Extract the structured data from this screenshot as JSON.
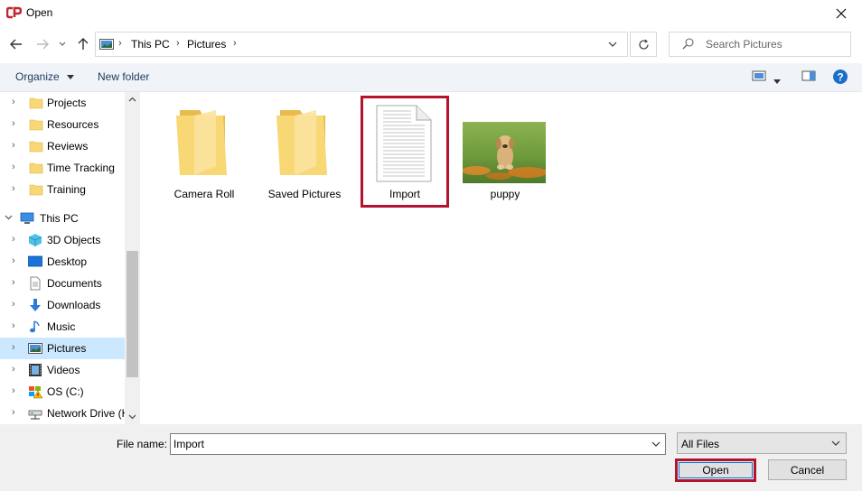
{
  "window": {
    "title": "Open"
  },
  "nav": {
    "crumbs": [
      "This PC",
      "Pictures"
    ],
    "search_placeholder": "Search Pictures"
  },
  "toolbar": {
    "organize": "Organize",
    "new_folder": "New folder"
  },
  "sidebar": {
    "items": [
      {
        "label": "Projects",
        "icon": "folder-icon"
      },
      {
        "label": "Resources",
        "icon": "folder-icon"
      },
      {
        "label": "Reviews",
        "icon": "folder-icon"
      },
      {
        "label": "Time Tracking",
        "icon": "folder-icon"
      },
      {
        "label": "Training",
        "icon": "folder-icon"
      },
      {
        "label": "This PC",
        "icon": "computer-icon"
      },
      {
        "label": "3D Objects",
        "icon": "cube-icon"
      },
      {
        "label": "Desktop",
        "icon": "desktop-icon"
      },
      {
        "label": "Documents",
        "icon": "document-icon"
      },
      {
        "label": "Downloads",
        "icon": "download-icon"
      },
      {
        "label": "Music",
        "icon": "music-icon"
      },
      {
        "label": "Pictures",
        "icon": "pictures-icon"
      },
      {
        "label": "Videos",
        "icon": "video-icon"
      },
      {
        "label": "OS (C:)",
        "icon": "drive-icon"
      },
      {
        "label": "Network Drive (H",
        "icon": "network-drive-icon"
      }
    ],
    "selected": "Pictures"
  },
  "files": [
    {
      "name": "Camera Roll",
      "type": "folder"
    },
    {
      "name": "Saved Pictures",
      "type": "folder"
    },
    {
      "name": "Import",
      "type": "document"
    },
    {
      "name": "puppy",
      "type": "image"
    }
  ],
  "bottom": {
    "filename_label": "File name:",
    "filename_value": "Import",
    "filter": "All Files",
    "open": "Open",
    "cancel": "Cancel"
  },
  "colors": {
    "highlight": "#b5122d",
    "selection": "#cce8ff",
    "folder": "#f8d775"
  }
}
